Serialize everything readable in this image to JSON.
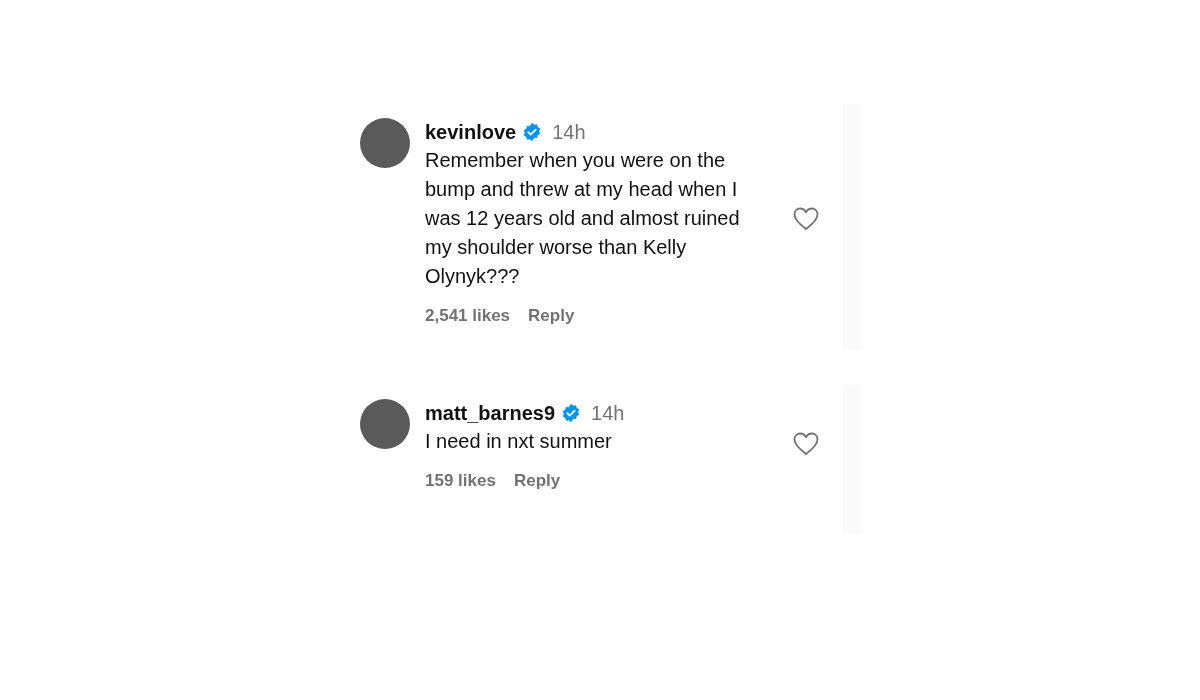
{
  "comments": [
    {
      "username": "kevinlove",
      "verified": true,
      "time": "14h",
      "text": "Remember when you were on the bump and threw at my head when I was 12 years old and almost ruined my shoulder worse than Kelly Olynyk???",
      "likes": "2,541 likes",
      "reply": "Reply",
      "liked": false
    },
    {
      "username": "matt_barnes9",
      "verified": true,
      "time": "14h",
      "text": "I need in nxt summer",
      "likes": "159 likes",
      "reply": "Reply",
      "liked": false
    }
  ]
}
